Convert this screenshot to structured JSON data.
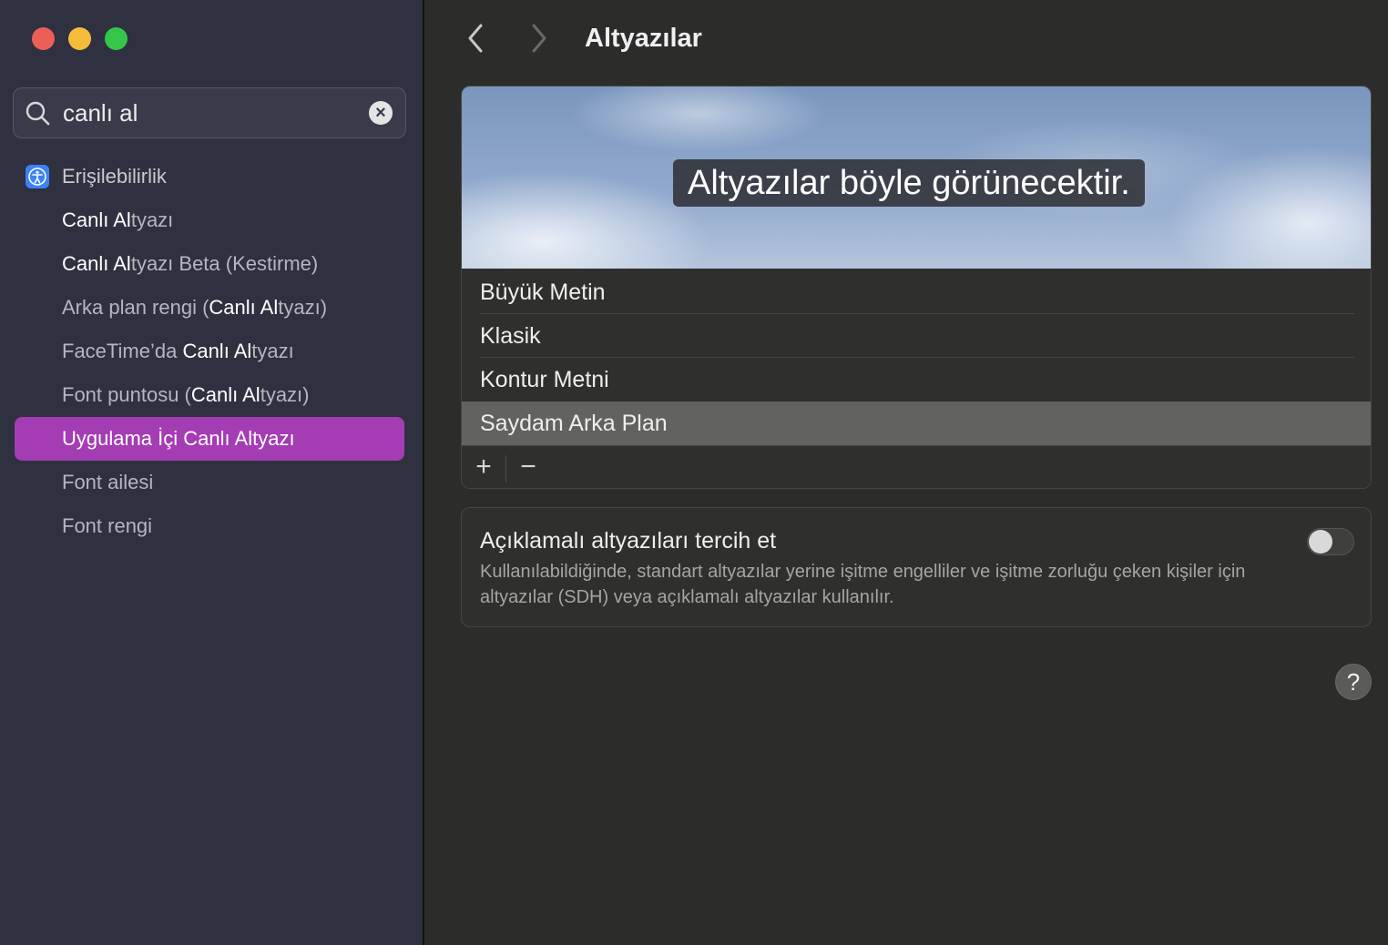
{
  "window": {
    "title": "Altyazılar"
  },
  "search": {
    "value": "canlı al"
  },
  "sidebar": {
    "header": "Erişilebilirlik",
    "items": [
      {
        "parts": [
          {
            "t": "Canlı Al",
            "b": true
          },
          {
            "t": "tyazı",
            "b": false
          }
        ]
      },
      {
        "parts": [
          {
            "t": "Canlı Al",
            "b": true
          },
          {
            "t": "tyazı Beta (Kestirme)",
            "b": false
          }
        ]
      },
      {
        "parts": [
          {
            "t": "Arka plan rengi (",
            "b": false
          },
          {
            "t": "Canlı Al",
            "b": true
          },
          {
            "t": "tyazı)",
            "b": false
          }
        ]
      },
      {
        "parts": [
          {
            "t": "FaceTime’da ",
            "b": false
          },
          {
            "t": "Canlı Al",
            "b": true
          },
          {
            "t": "tyazı",
            "b": false
          }
        ]
      },
      {
        "parts": [
          {
            "t": "Font puntosu (",
            "b": false
          },
          {
            "t": "Canlı Al",
            "b": true
          },
          {
            "t": "tyazı)",
            "b": false
          }
        ]
      },
      {
        "parts": [
          {
            "t": "Uygulama İçi ",
            "b": false
          },
          {
            "t": "Canlı Al",
            "b": true
          },
          {
            "t": "tyazı",
            "b": false
          }
        ],
        "selected": true
      },
      {
        "parts": [
          {
            "t": "Font ailesi",
            "b": false
          }
        ]
      },
      {
        "parts": [
          {
            "t": "Font rengi",
            "b": false
          }
        ]
      }
    ]
  },
  "preview": {
    "caption": "Altyazılar böyle görünecektir."
  },
  "styles": [
    {
      "label": "Büyük Metin",
      "selected": false
    },
    {
      "label": "Klasik",
      "selected": false
    },
    {
      "label": "Kontur Metni",
      "selected": false
    },
    {
      "label": "Saydam Arka Plan",
      "selected": true
    }
  ],
  "style_actions": {
    "add": "+",
    "remove": "−"
  },
  "sdh": {
    "title": "Açıklamalı altyazıları tercih et",
    "description": "Kullanılabildiğinde, standart altyazılar yerine işitme engelliler ve işitme zorluğu çeken kişiler için altyazılar (SDH) veya açıklamalı altyazılar kullanılır.",
    "enabled": false
  },
  "help": {
    "label": "?"
  }
}
